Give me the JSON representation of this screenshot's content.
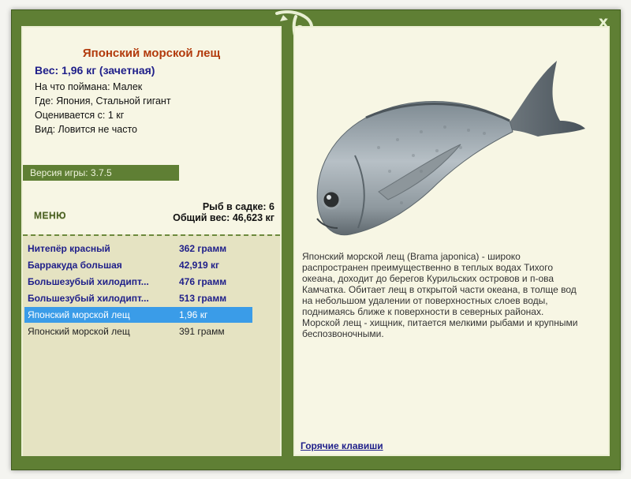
{
  "window": {
    "close_label": "x"
  },
  "fish": {
    "title": "Японский морской лещ",
    "weight": "Вес: 1,96 кг (зачетная)",
    "info": [
      "На что поймана: Малек",
      "Где: Япония, Стальной гигант",
      "Оценивается с: 1 кг",
      "Вид: Ловится не часто"
    ]
  },
  "version": "Версия игры: 3.7.5",
  "menu_label": "МЕНЮ",
  "stats": {
    "fish_in_keepnet": "Рыб в садке: 6",
    "total_weight": "Общий вес: 46,623 кг"
  },
  "catch_list": [
    {
      "name": "Нитепёр красный",
      "weight": "362 грамм",
      "style": "bold"
    },
    {
      "name": "Барракуда большая",
      "weight": "42,919 кг",
      "style": "bold"
    },
    {
      "name": "Большезубый хилодипт...",
      "weight": "476 грамм",
      "style": "bold"
    },
    {
      "name": "Большезубый хилодипт...",
      "weight": "513 грамм",
      "style": "bold"
    },
    {
      "name": "Японский морской лещ",
      "weight": "1,96 кг",
      "style": "selected"
    },
    {
      "name": "Японский морской лещ",
      "weight": "391 грамм",
      "style": "plain"
    }
  ],
  "description": "Японский морской лещ (Brama japonica) - широко распространен преимущественно в теплых водах Тихого океана, доходит до берегов Курильских островов и п-ова Камчатка. Обитает лещ в открытой части океана, в толще вод на небольшом удалении от поверхностных слоев воды, поднимаясь ближе к поверхности в северных районах. Морской лещ - хищник, питается мелкими рыбами и крупными беспозвоночными.",
  "hotkeys_label": "Горячие клавиши",
  "colors": {
    "frame_green": "#5f7f34",
    "panel_bg": "#f7f6e4",
    "title_red": "#b23a0c",
    "navy": "#20208a",
    "selection_blue": "#3a9ce8"
  }
}
